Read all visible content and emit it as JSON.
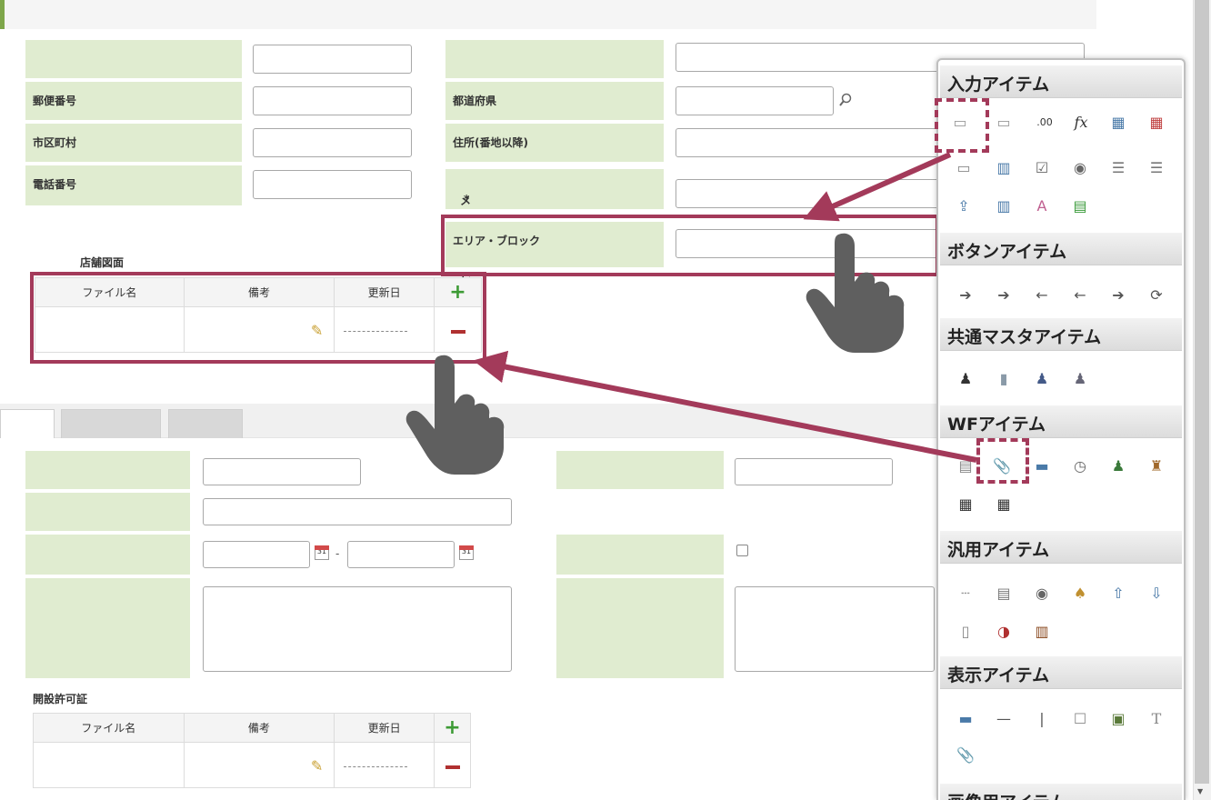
{
  "top_form": {
    "fields_left": [
      {
        "label": "",
        "value": ""
      },
      {
        "label": "郵便番号",
        "value": ""
      },
      {
        "label": "市区町村",
        "value": ""
      },
      {
        "label": "電話番号",
        "value": ""
      }
    ],
    "fields_right": [
      {
        "label": "",
        "value": ""
      },
      {
        "label": "都道府県",
        "value": ""
      },
      {
        "label": "住所(番地以降)",
        "value": ""
      },
      {
        "label": "メールアドレス",
        "required_mark": "*",
        "value": ""
      },
      {
        "label": "エリア・ブロック",
        "value": ""
      }
    ]
  },
  "store_drawing": {
    "caption": "店舗図面",
    "columns": [
      "ファイル名",
      "備考",
      "更新日"
    ]
  },
  "permit": {
    "caption": "開設許可証",
    "columns": [
      "ファイル名",
      "備考",
      "更新日"
    ]
  },
  "tabs": {
    "labels": [
      "",
      "",
      ""
    ]
  },
  "date_range": {
    "separator": "-"
  },
  "palette": {
    "sections": [
      {
        "title": "入力アイテム"
      },
      {
        "title": "ボタンアイテム"
      },
      {
        "title": "共通マスタアイテム"
      },
      {
        "title": "WFアイテム"
      },
      {
        "title": "汎用アイテム"
      },
      {
        "title": "表示アイテム"
      },
      {
        "title": "画像用アイテム"
      }
    ]
  },
  "colors": {
    "label_bg": "#e0ecd0",
    "highlight": "#a33a5a",
    "accent_green": "#7ea64a"
  }
}
